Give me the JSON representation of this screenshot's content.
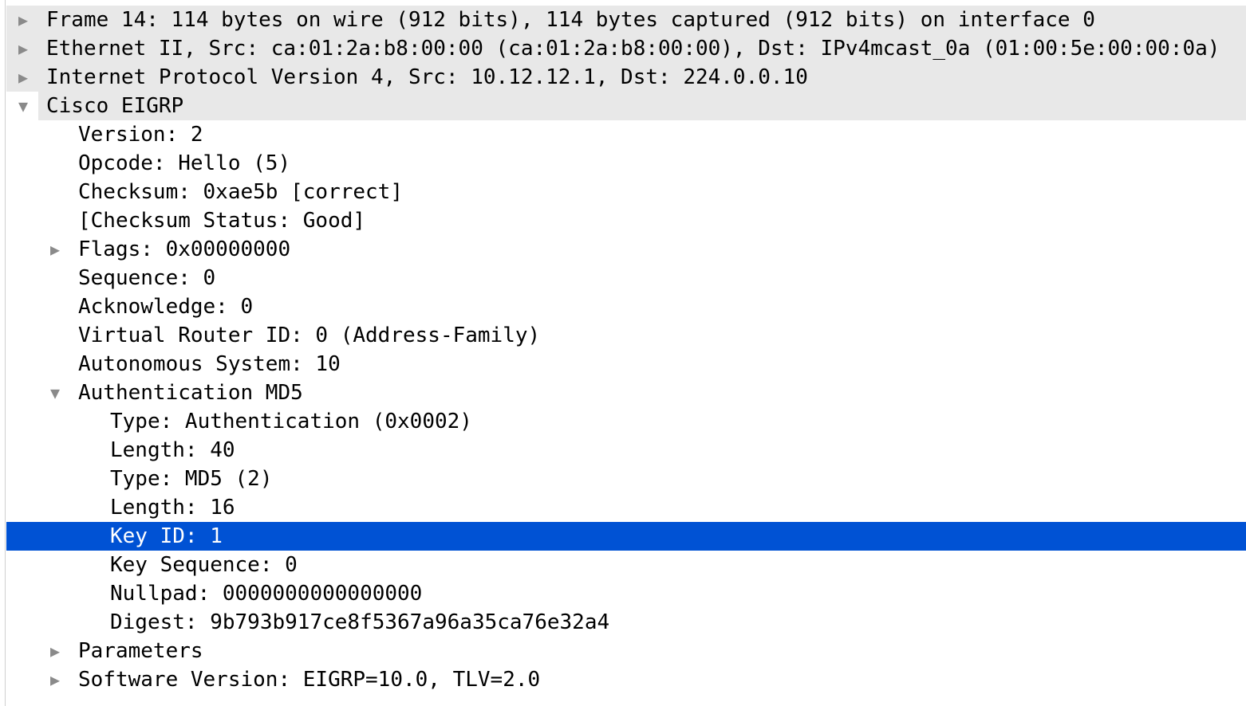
{
  "tree": {
    "frame": {
      "text": "Frame 14: 114 bytes on wire (912 bits), 114 bytes captured (912 bits) on interface 0",
      "expanded": false
    },
    "ethernet": {
      "text": "Ethernet II, Src: ca:01:2a:b8:00:00 (ca:01:2a:b8:00:00), Dst: IPv4mcast_0a (01:00:5e:00:00:0a)",
      "expanded": false
    },
    "ipv4": {
      "text": "Internet Protocol Version 4, Src: 10.12.12.1, Dst: 224.0.0.10",
      "expanded": false
    },
    "eigrp": {
      "text": "Cisco EIGRP",
      "expanded": true,
      "fields": {
        "version": "Version: 2",
        "opcode": "Opcode: Hello (5)",
        "checksum": "Checksum: 0xae5b [correct]",
        "checksum_status": "[Checksum Status: Good]",
        "flags": "Flags: 0x00000000",
        "sequence": "Sequence: 0",
        "acknowledge": "Acknowledge: 0",
        "virtual_router_id": "Virtual Router ID: 0 (Address-Family)",
        "autonomous_system": "Autonomous System: 10",
        "auth": {
          "text": "Authentication MD5",
          "expanded": true,
          "fields": {
            "type_auth": "Type: Authentication (0x0002)",
            "length_40": "Length: 40",
            "type_md5": "Type: MD5 (2)",
            "length_16": "Length: 16",
            "key_id": "Key ID: 1",
            "key_sequence": "Key Sequence: 0",
            "nullpad": "Nullpad: 0000000000000000",
            "digest": "Digest: 9b793b917ce8f5367a96a35ca76e32a4"
          }
        },
        "parameters": "Parameters",
        "software_version": "Software Version: EIGRP=10.0, TLV=2.0"
      }
    },
    "selected_row": "key_id"
  },
  "icons": {
    "collapsed": "triangle-right-icon",
    "expanded": "triangle-down-icon"
  },
  "colors": {
    "header_bg": "#e8e8e8",
    "selection_bg": "#0052d4",
    "selection_text": "#ffffff",
    "toggle": "#8a8a8a"
  }
}
